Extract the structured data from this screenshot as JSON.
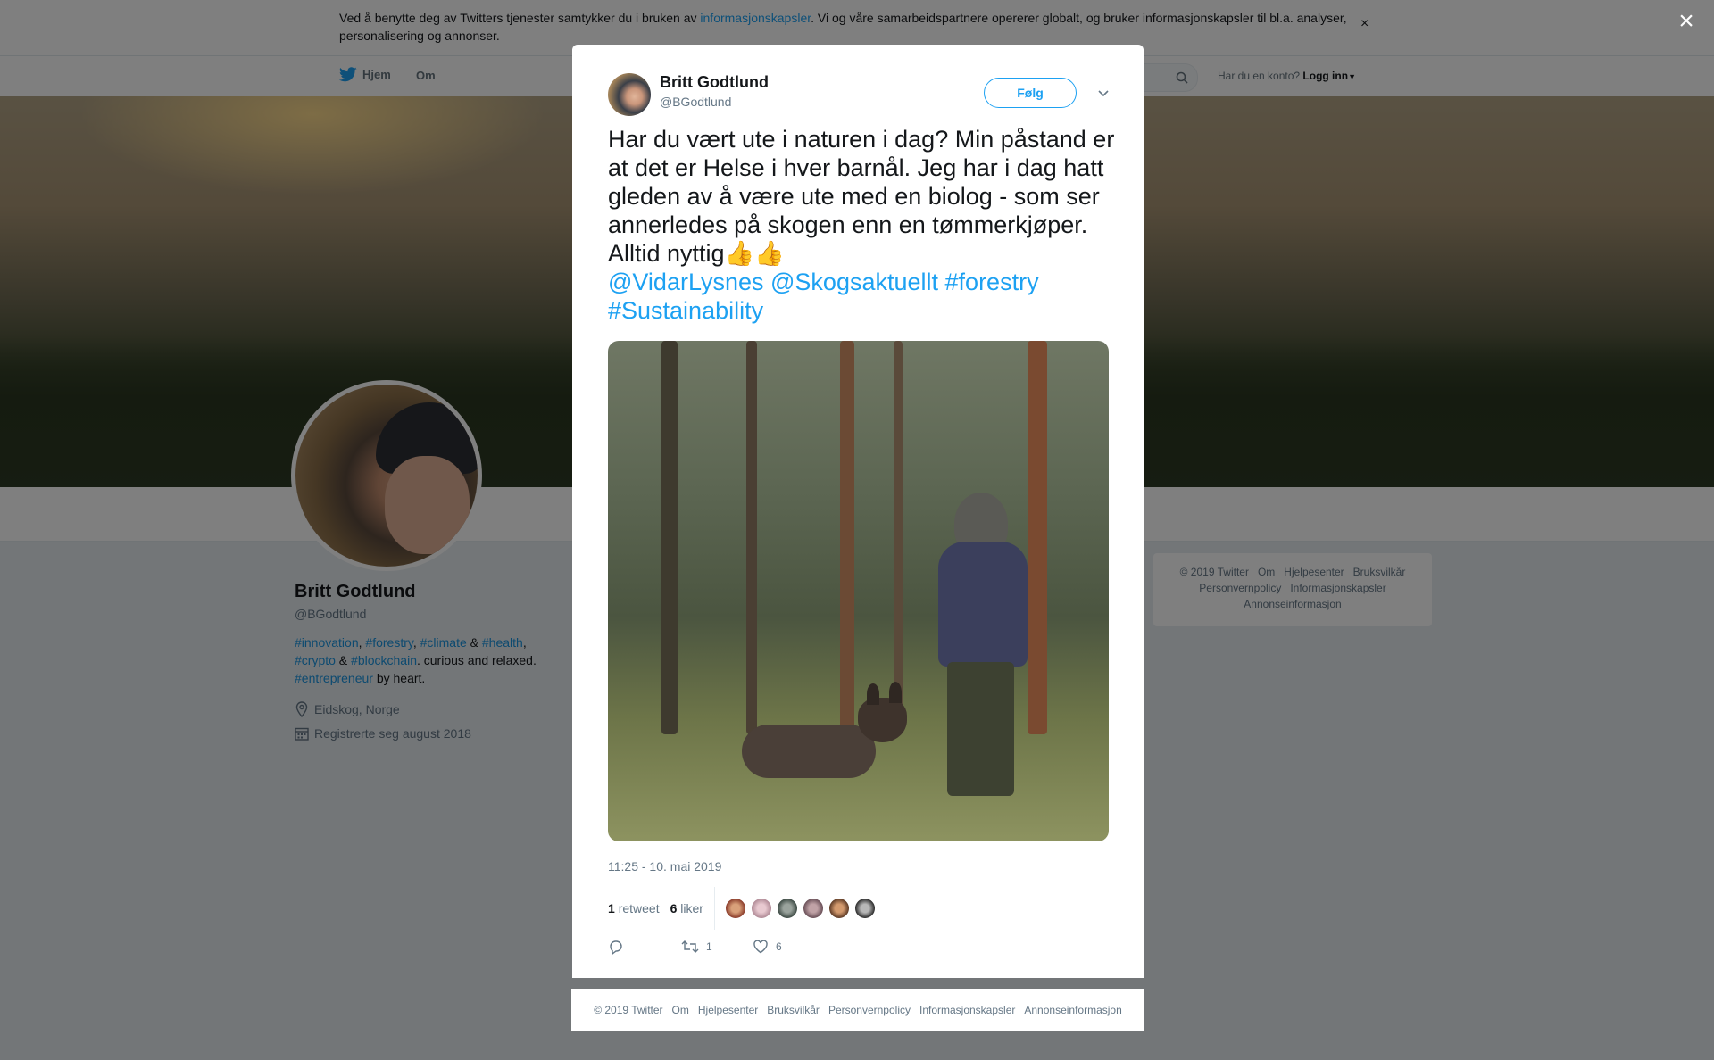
{
  "cookie_bar": {
    "text_before": "Ved å benytte deg av Twitters tjenester samtykker du i bruken av ",
    "link": "informasjonskapsler",
    "text_after": ". Vi og våre samarbeidspartnere opererer globalt, og bruker informasjonskapsler til bl.a. analyser, personalisering og annonser.",
    "close": "×"
  },
  "topnav": {
    "home": "Hjem",
    "about": "Om",
    "account_prompt": "Har du en konto?",
    "login": "Logg inn"
  },
  "profile": {
    "name": "Britt Godtlund",
    "handle": "@BGodtlund",
    "bio": {
      "h_innovation": "#innovation",
      "comma1": ", ",
      "h_forestry": "#forestry",
      "comma2": ", ",
      "h_climate": "#climate",
      "amp1": " & ",
      "h_health": "#health",
      "comma3": ",",
      "h_crypto": "#crypto",
      "amp2": " & ",
      "h_blockchain": "#blockchain",
      "curious": ". curious and relaxed.",
      "h_entrepreneur": "#entrepreneur",
      "byheart": " by heart."
    },
    "location": "Eidskog, Norge",
    "joined": "Registrerte seg august 2018"
  },
  "right_footer": {
    "links": [
      "© 2019 Twitter",
      "Om",
      "Hjelpesenter",
      "Bruksvilkår",
      "Personvernpolicy",
      "Informasjonskapsler",
      "Annonseinformasjon"
    ]
  },
  "overlay": {
    "close": "×"
  },
  "tweet": {
    "author_name": "Britt Godtlund",
    "author_handle": "@BGodtlund",
    "follow_label": "Følg",
    "text": "Har du vært ute i naturen i dag? Min påstand er at det er Helse i hver barnål. Jeg har i dag hatt gleden av å være ute med en biolog - som ser annerledes på skogen enn en tømmerkjøper. Alltid nyttig👍👍",
    "mention1": "@VidarLysnes",
    "mention2": "@Skogsaktuellt",
    "hashtag1": "#forestry",
    "hashtag2": "#Sustainability",
    "timestamp": "11:25 - 10. mai 2019",
    "retweet_count": "1",
    "retweet_label": "retweet",
    "like_count": "6",
    "like_label": "liker",
    "action_retweets": "1",
    "action_likes": "6"
  },
  "modal_footer": {
    "links": [
      "© 2019 Twitter",
      "Om",
      "Hjelpesenter",
      "Bruksvilkår",
      "Personvernpolicy",
      "Informasjonskapsler",
      "Annonseinformasjon"
    ]
  },
  "colors": {
    "twitter_blue": "#1da1f2",
    "text_primary": "#14171a",
    "text_secondary": "#657786"
  }
}
